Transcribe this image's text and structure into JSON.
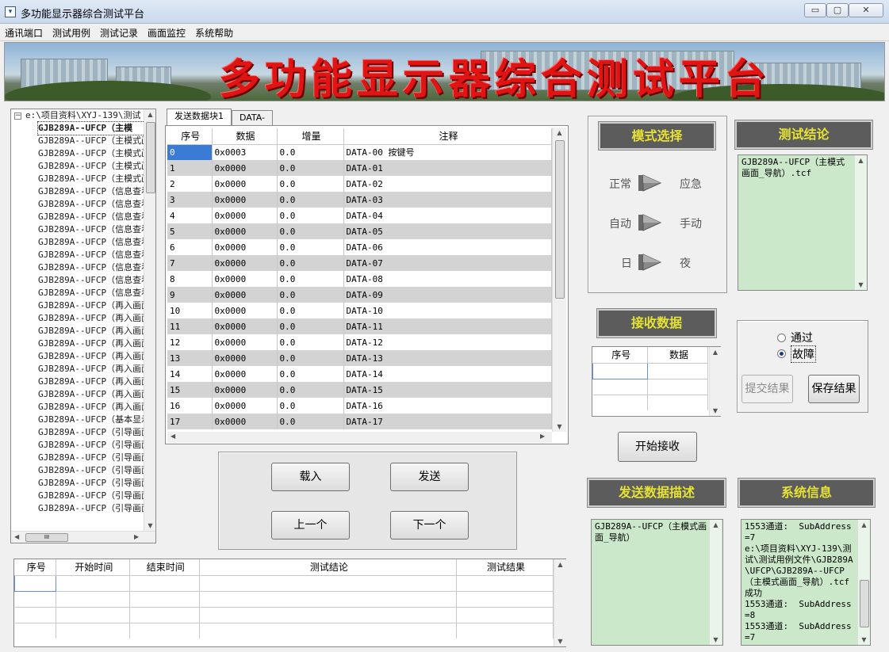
{
  "window": {
    "title": "多功能显示器综合测试平台",
    "app_icon": "app-icon",
    "min": "▭",
    "max": "▢",
    "close": "✕"
  },
  "menu": [
    "通讯端口",
    "测试用例",
    "测试记录",
    "画面监控",
    "系统帮助"
  ],
  "banner": {
    "title": "多功能显示器综合测试平台"
  },
  "tree": {
    "root": "e:\\项目资料\\XYJ-139\\测试",
    "items": [
      "GJB289A--UFCP（主模",
      "GJB289A--UFCP（主模式画",
      "GJB289A--UFCP（主模式画",
      "GJB289A--UFCP（主模式画",
      "GJB289A--UFCP（主模式画",
      "GJB289A--UFCP（信息查看",
      "GJB289A--UFCP（信息查看",
      "GJB289A--UFCP（信息查看",
      "GJB289A--UFCP（信息查看",
      "GJB289A--UFCP（信息查看",
      "GJB289A--UFCP（信息查看",
      "GJB289A--UFCP（信息查看",
      "GJB289A--UFCP（信息查看",
      "GJB289A--UFCP（信息查看",
      "GJB289A--UFCP（再入画面",
      "GJB289A--UFCP（再入画面",
      "GJB289A--UFCP（再入画面",
      "GJB289A--UFCP（再入画面",
      "GJB289A--UFCP（再入画面",
      "GJB289A--UFCP（再入画面",
      "GJB289A--UFCP（再入画面",
      "GJB289A--UFCP（再入画面",
      "GJB289A--UFCP（再入画面",
      "GJB289A--UFCP（基本显示",
      "GJB289A--UFCP（引导画面",
      "GJB289A--UFCP（引导画面",
      "GJB289A--UFCP（引导画面",
      "GJB289A--UFCP（引导画面",
      "GJB289A--UFCP（引导画面",
      "GJB289A--UFCP（引导画面",
      "GJB289A--UFCP（引导画面"
    ],
    "hscroll_thumb": "III"
  },
  "tabs": [
    "发送数据块1",
    "DATA-"
  ],
  "data_table": {
    "headers": [
      "序号",
      "数据",
      "增量",
      "注释"
    ],
    "rows": [
      [
        "0",
        "0x0003",
        "0.0",
        "DATA-00  按键号"
      ],
      [
        "1",
        "0x0000",
        "0.0",
        "DATA-01"
      ],
      [
        "2",
        "0x0000",
        "0.0",
        "DATA-02"
      ],
      [
        "3",
        "0x0000",
        "0.0",
        "DATA-03"
      ],
      [
        "4",
        "0x0000",
        "0.0",
        "DATA-04"
      ],
      [
        "5",
        "0x0000",
        "0.0",
        "DATA-05"
      ],
      [
        "6",
        "0x0000",
        "0.0",
        "DATA-06"
      ],
      [
        "7",
        "0x0000",
        "0.0",
        "DATA-07"
      ],
      [
        "8",
        "0x0000",
        "0.0",
        "DATA-08"
      ],
      [
        "9",
        "0x0000",
        "0.0",
        "DATA-09"
      ],
      [
        "10",
        "0x0000",
        "0.0",
        "DATA-10"
      ],
      [
        "11",
        "0x0000",
        "0.0",
        "DATA-11"
      ],
      [
        "12",
        "0x0000",
        "0.0",
        "DATA-12"
      ],
      [
        "13",
        "0x0000",
        "0.0",
        "DATA-13"
      ],
      [
        "14",
        "0x0000",
        "0.0",
        "DATA-14"
      ],
      [
        "15",
        "0x0000",
        "0.0",
        "DATA-15"
      ],
      [
        "16",
        "0x0000",
        "0.0",
        "DATA-16"
      ],
      [
        "17",
        "0x0000",
        "0.0",
        "DATA-17"
      ]
    ]
  },
  "buttons": {
    "load": "载入",
    "send": "发送",
    "prev": "上一个",
    "next": "下一个",
    "start_receive": "开始接收",
    "submit": "提交结果",
    "save": "保存结果"
  },
  "mode": {
    "header": "模式选择",
    "toggles": [
      {
        "left": "正常",
        "right": "应急"
      },
      {
        "left": "自动",
        "right": "手动"
      },
      {
        "left": "日",
        "right": "夜"
      }
    ]
  },
  "conclusion": {
    "header": "测试结论",
    "text": "GJB289A--UFCP（主模式画面_导航）.tcf"
  },
  "receive": {
    "header": "接收数据",
    "headers": [
      "序号",
      "数据"
    ]
  },
  "result": {
    "options": [
      "通过",
      "故障"
    ],
    "selected": "故障"
  },
  "send_desc": {
    "header": "发送数据描述",
    "text": "GJB289A--UFCP（主模式画面_导航）"
  },
  "sysinfo": {
    "header": "系统信息",
    "text": "1553通道:  SubAddress=7\ne:\\项目资料\\XYJ-139\\测试\\测试用例文件\\GJB289A\\UFCP\\GJB289A--UFCP（主模式画面_导航）.tcf成功\n1553通道:  SubAddress=8\n1553通道:  SubAddress=7"
  },
  "record_table": {
    "headers": [
      "序号",
      "开始时间",
      "结束时间",
      "测试结论",
      "测试结果"
    ]
  },
  "colors": {
    "header_bg": "#5c5c5c",
    "header_text": "#e6e234",
    "green_panel": "#cbe8cb",
    "banner_title": "#e11414",
    "row_alt": "#d3d3d3"
  }
}
